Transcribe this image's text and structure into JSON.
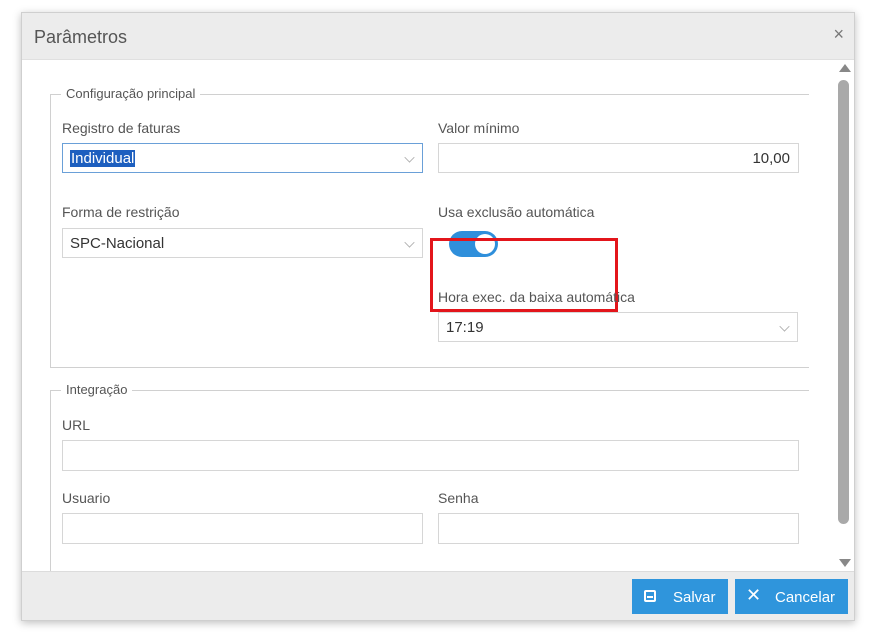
{
  "dialog": {
    "title": "Parâmetros",
    "close_glyph": "×"
  },
  "main_config": {
    "legend": "Configuração principal",
    "registro_label": "Registro de faturas",
    "registro_value": "Individual",
    "valor_label": "Valor mínimo",
    "valor_value": "10,00",
    "forma_label": "Forma de restrição",
    "forma_value": "SPC-Nacional",
    "usa_label": "Usa exclusão automática",
    "usa_enabled": true,
    "hora_label": "Hora exec. da baixa automática",
    "hora_value": "17:19"
  },
  "integration": {
    "legend": "Integração",
    "url_label": "URL",
    "url_value": "",
    "usuario_label": "Usuario",
    "usuario_value": "",
    "senha_label": "Senha",
    "senha_value": ""
  },
  "footer": {
    "save_label": "Salvar",
    "cancel_label": "Cancelar",
    "save_icon": "save-icon",
    "cancel_icon": "x-icon"
  },
  "colors": {
    "accent": "#2f95dc",
    "toggle_on": "#2f8fdb",
    "highlight": "#e3151b"
  }
}
